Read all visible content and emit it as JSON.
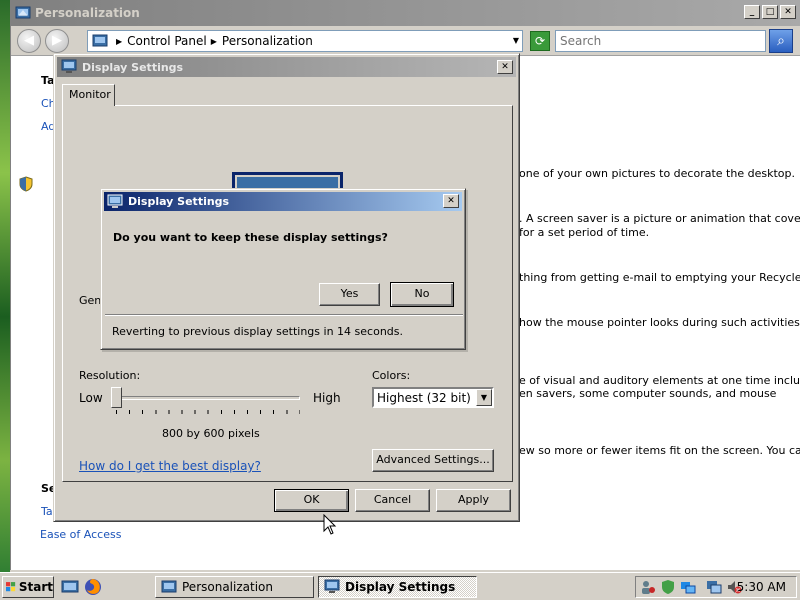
{
  "main_window": {
    "title": "Personalization",
    "caption": {
      "minimize": "_",
      "maximize": "□",
      "close": "✕"
    },
    "address": {
      "segment_1": "Control Panel",
      "segment_2": "Personalization",
      "separator": "▶",
      "dropdown": "▼"
    },
    "search": {
      "placeholder": "Search"
    },
    "left_nav": {
      "tasks_heading": "Ta",
      "link_1": "Ch",
      "link_2": "Ad",
      "see_also_heading": "Se",
      "link_3": "Tas",
      "ease_of_access": "Ease of Access"
    },
    "right_text": [
      "one of your own pictures to decorate the desktop.",
      ". A screen saver is a picture or animation that covers",
      " for a set period of time.",
      "thing from getting e-mail to emptying your Recycle Bin.",
      "how the mouse pointer looks during such activities as",
      "e of visual and auditory elements at one time including",
      "en savers, some computer sounds, and mouse",
      "ew so more or fewer items fit on the screen. You can"
    ]
  },
  "display_settings": {
    "title": "Display Settings",
    "close": "✕",
    "tab_monitor": "Monitor",
    "general_label": "Gen",
    "resolution_label": "Resolution:",
    "low": "Low",
    "high": "High",
    "resolution_value": "800 by 600 pixels",
    "resolution_slider_fraction": 0.0,
    "colors_label": "Colors:",
    "colors_value": "Highest (32 bit)",
    "help_link": "How do I get the best display?",
    "advanced_button": "Advanced Settings...",
    "ok_button": "OK",
    "cancel_button": "Cancel",
    "apply_button": "Apply"
  },
  "confirm_dialog": {
    "title": "Display Settings",
    "close": "✕",
    "question": "Do you want to keep these display settings?",
    "yes_button": "Yes",
    "no_button": "No",
    "revert_text": "Reverting to previous display settings in 14 seconds."
  },
  "taskbar": {
    "start": "Start",
    "tasks": [
      {
        "label": "Personalization",
        "active": false
      },
      {
        "label": "Display Settings",
        "active": true
      }
    ],
    "clock": "5:30 AM"
  },
  "colors": {
    "active_title_start": "#0a246a",
    "active_title_end": "#a6caf0",
    "inactive_title": "#808080",
    "link": "#1a52b8",
    "face": "#d4d0c8"
  }
}
